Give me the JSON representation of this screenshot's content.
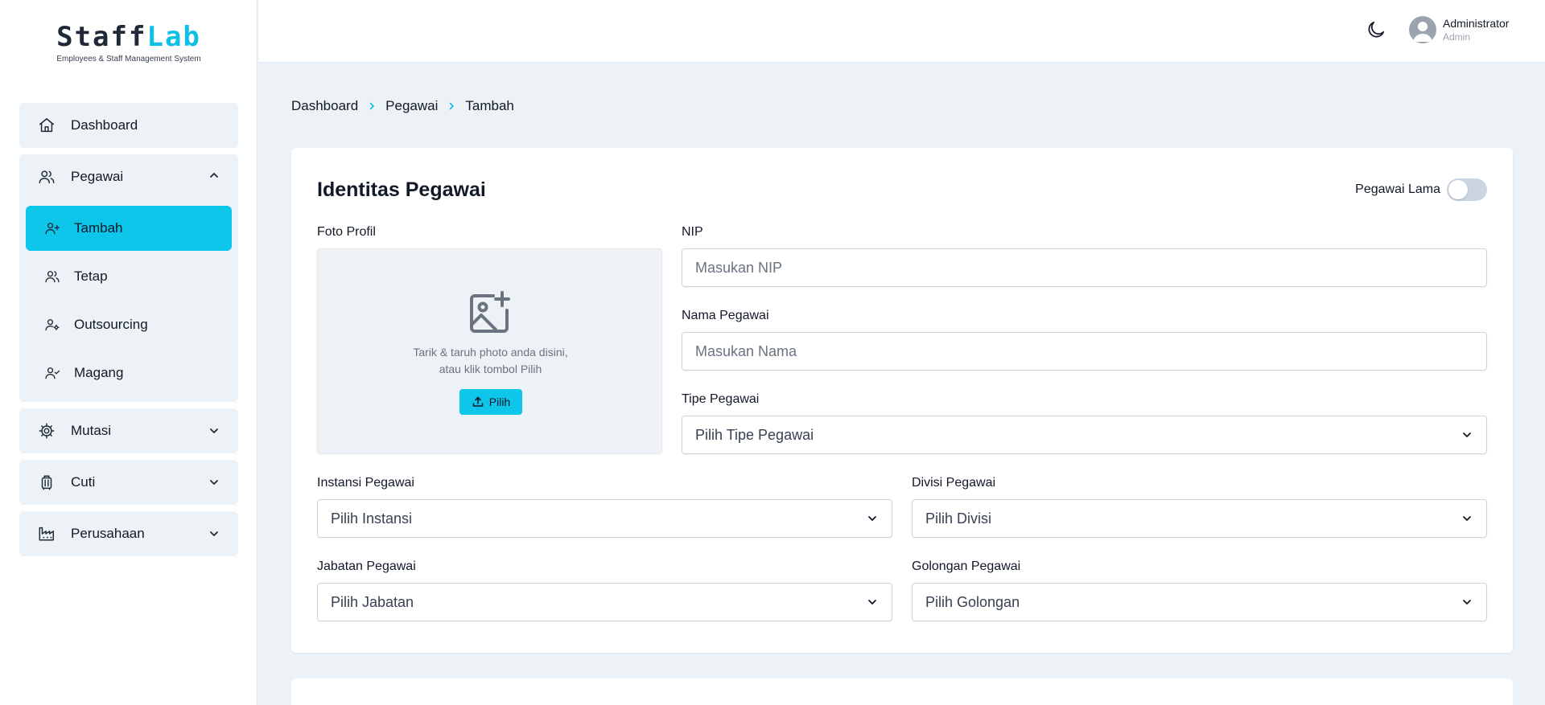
{
  "brand": {
    "name_part1": "Staff",
    "name_part2": "Lab",
    "tagline": "Employees & Staff Management System"
  },
  "sidebar": {
    "dashboard": "Dashboard",
    "pegawai": {
      "label": "Pegawai",
      "items": [
        {
          "label": "Tambah",
          "active": true
        },
        {
          "label": "Tetap"
        },
        {
          "label": "Outsourcing"
        },
        {
          "label": "Magang"
        }
      ]
    },
    "mutasi": "Mutasi",
    "cuti": "Cuti",
    "perusahaan": "Perusahaan"
  },
  "header": {
    "user_name": "Administrator",
    "user_role": "Admin",
    "theme_icon": "moon-icon"
  },
  "breadcrumb": [
    "Dashboard",
    "Pegawai",
    "Tambah"
  ],
  "form": {
    "title": "Identitas Pegawai",
    "toggle_label": "Pegawai Lama",
    "toggle_on": false,
    "photo": {
      "label": "Foto Profil",
      "hint_line1": "Tarik & taruh photo anda disini,",
      "hint_line2": "atau klik tombol Pilih",
      "button": "Pilih"
    },
    "nip": {
      "label": "NIP",
      "placeholder": "Masukan NIP",
      "value": ""
    },
    "nama": {
      "label": "Nama Pegawai",
      "placeholder": "Masukan Nama",
      "value": ""
    },
    "tipe": {
      "label": "Tipe Pegawai",
      "selected": "Pilih Tipe Pegawai"
    },
    "instansi": {
      "label": "Instansi Pegawai",
      "selected": "Pilih Instansi"
    },
    "divisi": {
      "label": "Divisi Pegawai",
      "selected": "Pilih Divisi"
    },
    "jabatan": {
      "label": "Jabatan Pegawai",
      "selected": "Pilih Jabatan"
    },
    "golongan": {
      "label": "Golongan Pegawai",
      "selected": "Pilih Golongan"
    }
  },
  "colors": {
    "accent": "#0ec5ea",
    "background": "#edf2f6"
  }
}
